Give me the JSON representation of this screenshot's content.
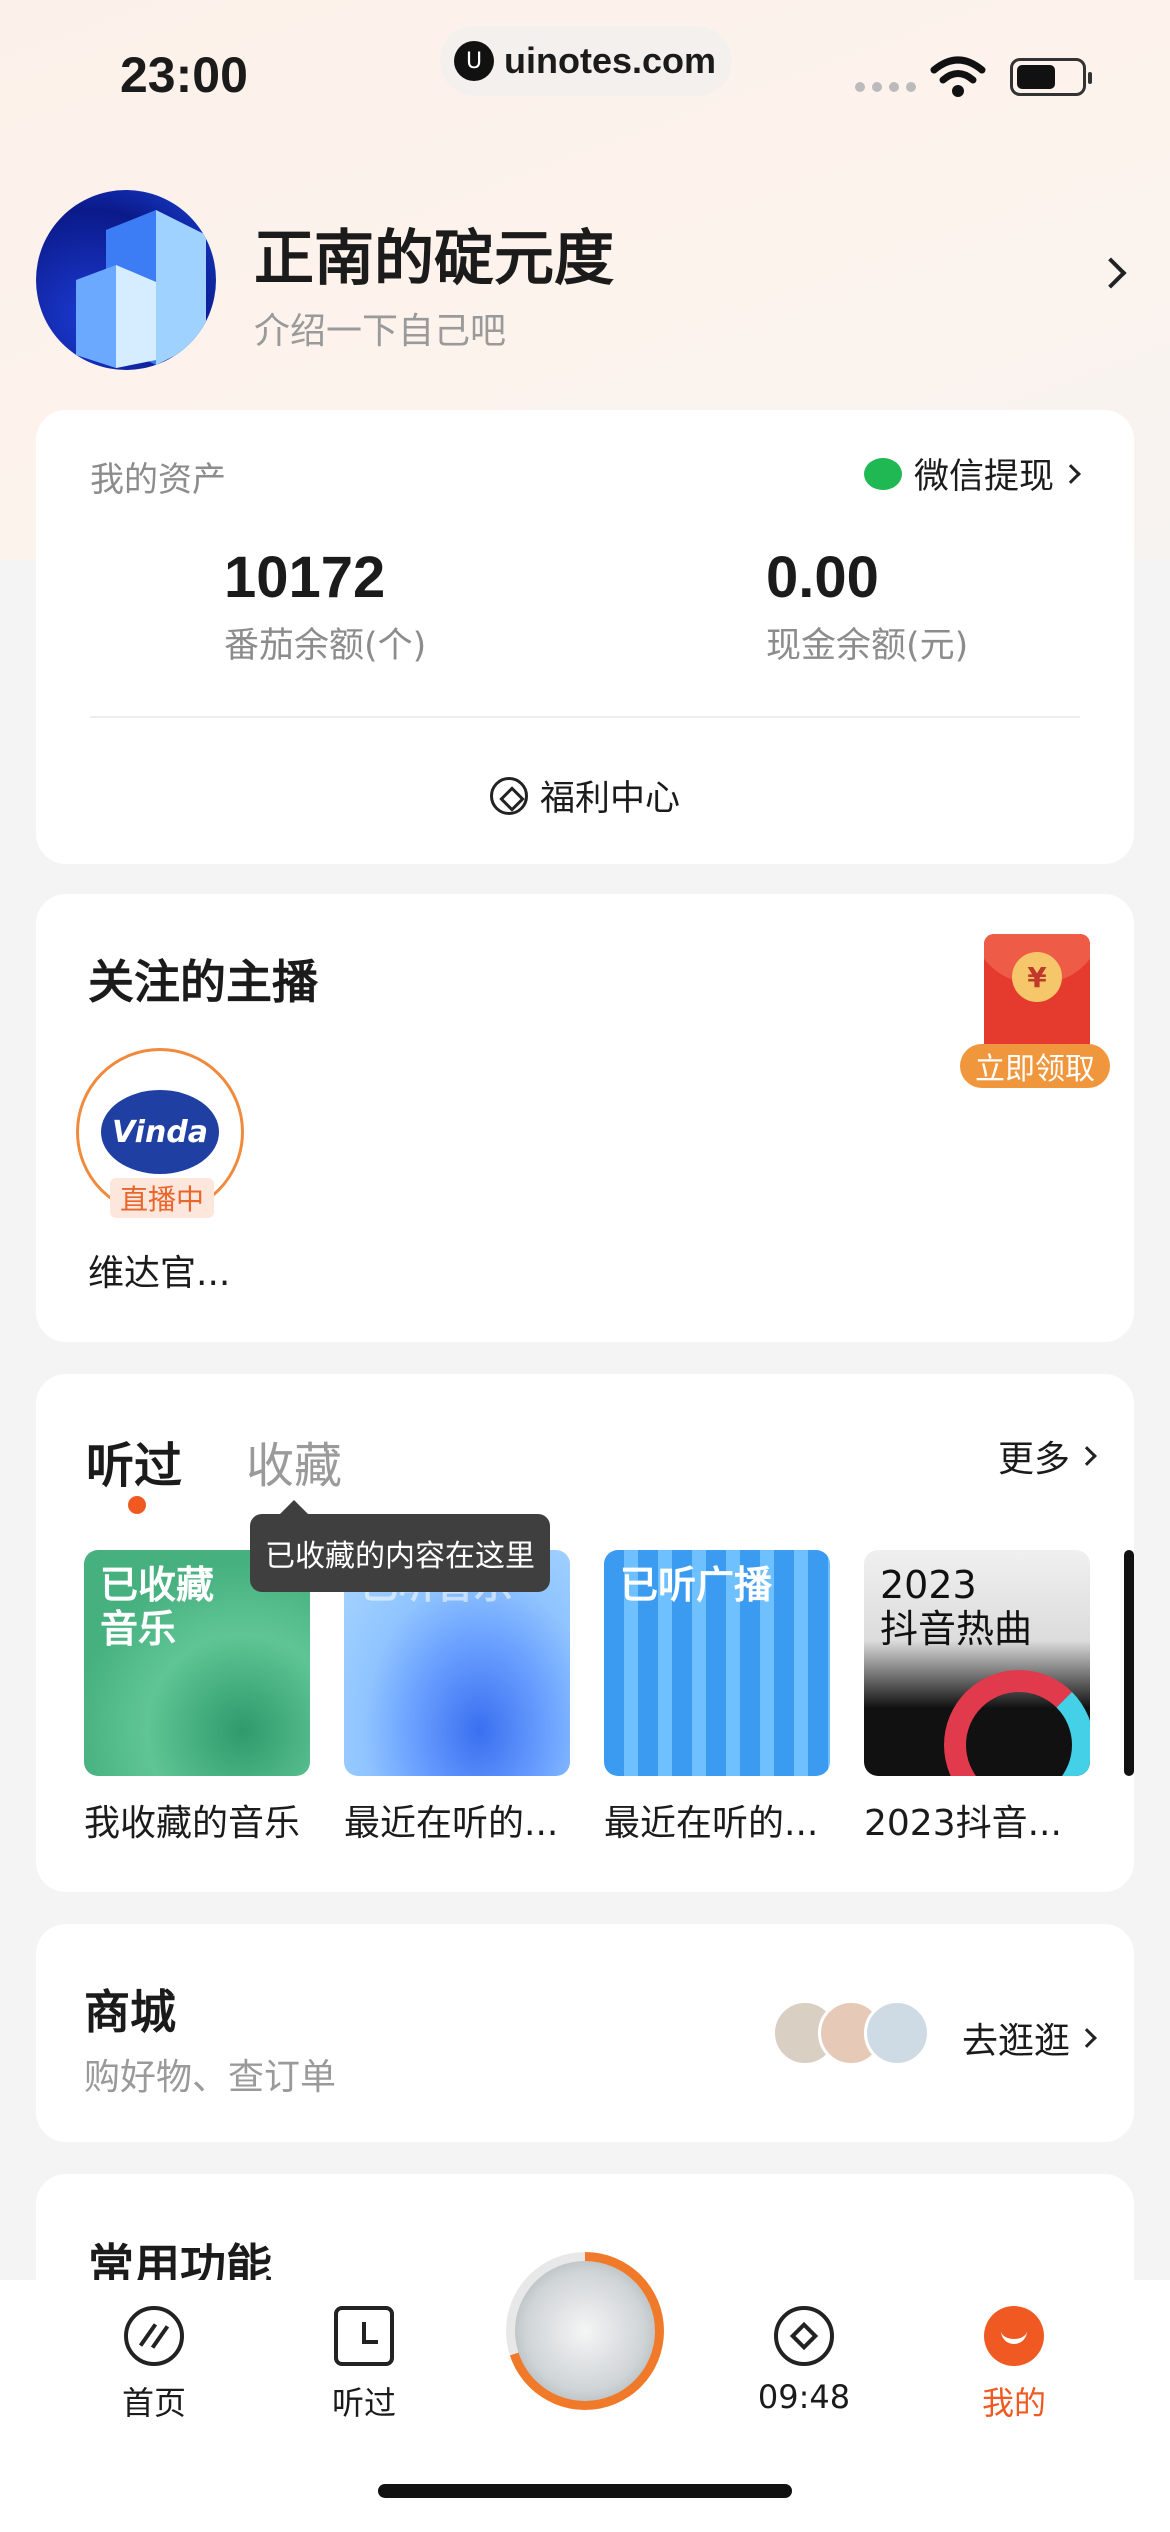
{
  "status_bar": {
    "time": "23:00",
    "url": "uinotes.com",
    "logo_glyph": "U"
  },
  "profile": {
    "username": "正南的碇元度",
    "bio": "介绍一下自己吧"
  },
  "assets": {
    "title": "我的资产",
    "wechat_withdraw": "微信提现",
    "tomato_balance": "10172",
    "tomato_label": "番茄余额(个)",
    "cash_balance": "0.00",
    "cash_label": "现金余额(元)",
    "welfare_center": "福利中心"
  },
  "followed": {
    "title": "关注的主播",
    "redpacket_symbol": "¥",
    "claim_label": "立即领取",
    "anchors": [
      {
        "name": "维达官...",
        "badge": "直播中",
        "logo_text": "Vinda"
      }
    ]
  },
  "history": {
    "tab_heard": "听过",
    "tab_fav": "收藏",
    "more": "更多",
    "tooltip": "已收藏的内容在这里",
    "items": [
      {
        "cover_text": "已收藏\n音乐",
        "label": "我收藏的音乐"
      },
      {
        "cover_text": "已听音乐",
        "label": "最近在听的..."
      },
      {
        "cover_text": "已听广播",
        "label": "最近在听的..."
      },
      {
        "cover_text": "2023\n抖音热曲",
        "label": "2023抖音..."
      }
    ]
  },
  "shop": {
    "title": "商城",
    "subtitle": "购好物、查订单",
    "go": "去逛逛"
  },
  "common": {
    "title": "常用功能"
  },
  "tabbar": {
    "home": "首页",
    "heard": "听过",
    "timer": "09:48",
    "mine": "我的"
  },
  "colors": {
    "accent": "#f05a22",
    "wechat": "#1fb853",
    "live": "#e8662b"
  }
}
